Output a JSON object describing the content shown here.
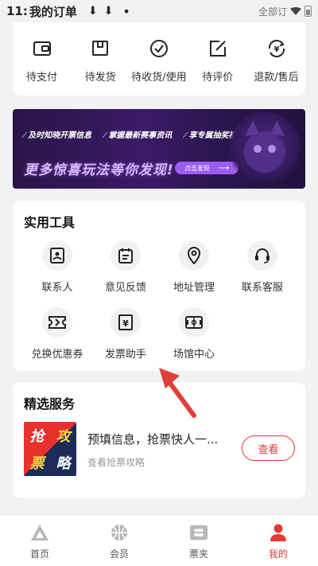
{
  "status_bar": {
    "time": "11:",
    "title": "我的订单",
    "download_glyphs": "⬇⬇",
    "dot": "•",
    "carrier_text": "全部订"
  },
  "orders": [
    {
      "label": "待支付",
      "icon": "wallet-icon"
    },
    {
      "label": "待发货",
      "icon": "package-icon"
    },
    {
      "label": "待收货/使用",
      "icon": "check-circle-icon"
    },
    {
      "label": "待评价",
      "icon": "edit-icon"
    },
    {
      "label": "退款/售后",
      "icon": "refund-icon"
    }
  ],
  "banner": {
    "tags": [
      "及时知晓开票信息",
      "掌握最新赛事资讯",
      "享专属抽奖福利"
    ],
    "headline": "更多惊喜玩法等你发现!",
    "cta": "点击发现",
    "cta_arrow": "⟶"
  },
  "tools": {
    "title": "实用工具",
    "items": [
      {
        "label": "联系人",
        "icon": "contact-card-icon"
      },
      {
        "label": "意见反馈",
        "icon": "feedback-icon"
      },
      {
        "label": "地址管理",
        "icon": "location-pin-icon"
      },
      {
        "label": "联系客服",
        "icon": "headset-icon"
      },
      {
        "label": "兑换优惠券",
        "icon": "coupon-icon"
      },
      {
        "label": "发票助手",
        "icon": "invoice-icon"
      },
      {
        "label": "场馆中心",
        "icon": "venue-icon"
      }
    ]
  },
  "services": {
    "title": "精选服务",
    "poster_chars": [
      "抢",
      "攻",
      "票",
      "略"
    ],
    "item_title": "预填信息，抢票快人一...",
    "item_sub": "查看抢票攻略",
    "button": "查看"
  },
  "tabbar": {
    "items": [
      {
        "label": "首页",
        "icon": "home-logo-icon",
        "active": false
      },
      {
        "label": "会员",
        "icon": "basketball-icon",
        "active": false
      },
      {
        "label": "票夹",
        "icon": "ticket-wallet-icon",
        "active": false
      },
      {
        "label": "我的",
        "icon": "person-icon",
        "active": true
      }
    ]
  },
  "colors": {
    "accent": "#e53935",
    "banner_purple": "#3b1a66",
    "page_bg": "#f2f2f4"
  }
}
